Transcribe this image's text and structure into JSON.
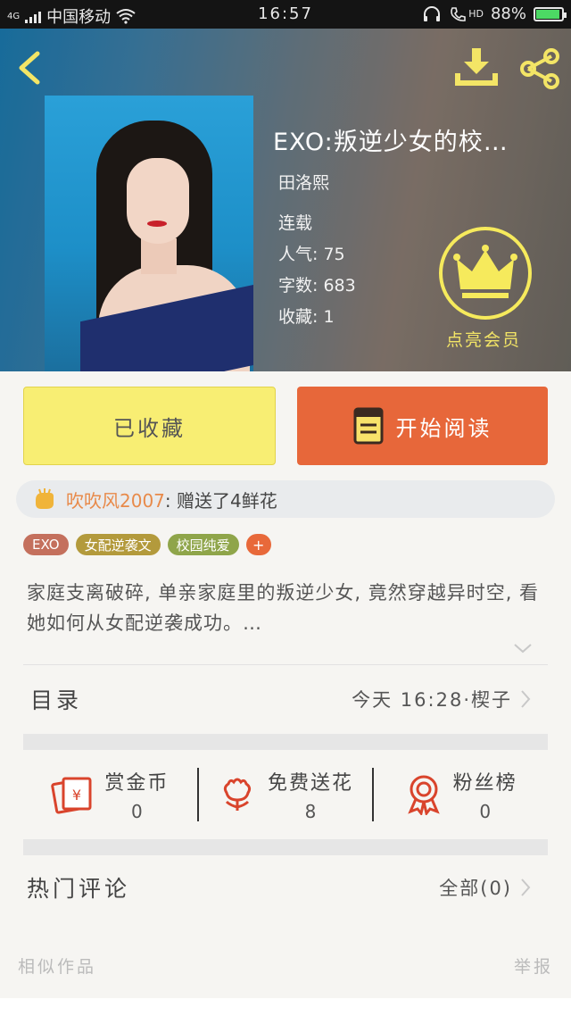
{
  "status_bar": {
    "network": "4G",
    "carrier": "中国移动",
    "time": "16:57",
    "hd": "HD",
    "battery": "88%",
    "battery_level": 0.88
  },
  "header": {
    "title": "EXO:叛逆少女的校…",
    "author": "田洛熙",
    "status": "连载",
    "popularity": "人气: 75",
    "words": "字数: 683",
    "favorites": "收藏: 1",
    "vip_label": "点亮会员"
  },
  "actions": {
    "favorited_label": "已收藏",
    "read_label": "开始阅读"
  },
  "gift_notice": {
    "user": "吹吹风2007",
    "text": ": 赠送了4鲜花"
  },
  "tags": [
    {
      "label": "EXO",
      "color": "#c4705d"
    },
    {
      "label": "女配逆袭文",
      "color": "#b39a3c"
    },
    {
      "label": "校园纯爱",
      "color": "#8fa54a"
    }
  ],
  "tag_add": "+",
  "description": "家庭支离破碎, 单亲家庭里的叛逆少女, 竟然穿越异时空, 看她如何从女配逆袭成功。…",
  "catalog": {
    "label": "目录",
    "latest": "今天 16:28·楔子"
  },
  "stats": [
    {
      "label": "赏金币",
      "count": "0",
      "icon": "reward-coin-icon"
    },
    {
      "label": "免费送花",
      "count": "8",
      "icon": "flower-icon"
    },
    {
      "label": "粉丝榜",
      "count": "0",
      "icon": "medal-icon"
    }
  ],
  "comments": {
    "label": "热门评论",
    "all": "全部(0)"
  },
  "footer": {
    "similar": "相似作品",
    "report": "举报"
  },
  "colors": {
    "accent_orange": "#e7673a",
    "favorite_yellow": "#f8ee73",
    "vip_yellow": "#f6ea5c"
  }
}
